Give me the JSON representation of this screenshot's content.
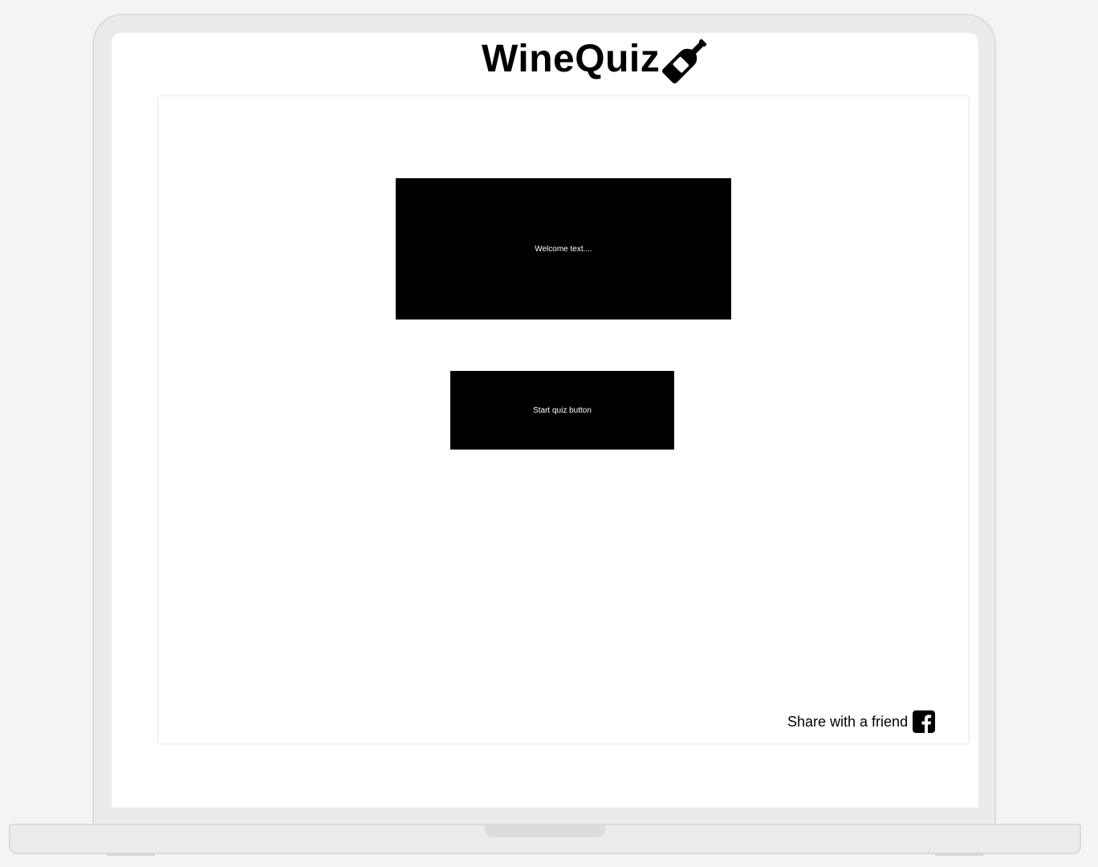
{
  "app": {
    "title": "WineQuiz",
    "logo_icon": "wine-bottle-icon"
  },
  "main": {
    "welcome_text": "Welcome text....",
    "start_button_label": "Start quiz button"
  },
  "footer": {
    "share_label": "Share with a friend",
    "share_icon": "facebook-icon"
  },
  "colors": {
    "page_background": "#f4f4f4",
    "screen_background": "#ffffff",
    "block_fill": "#000000",
    "block_text": "#ffffff"
  }
}
